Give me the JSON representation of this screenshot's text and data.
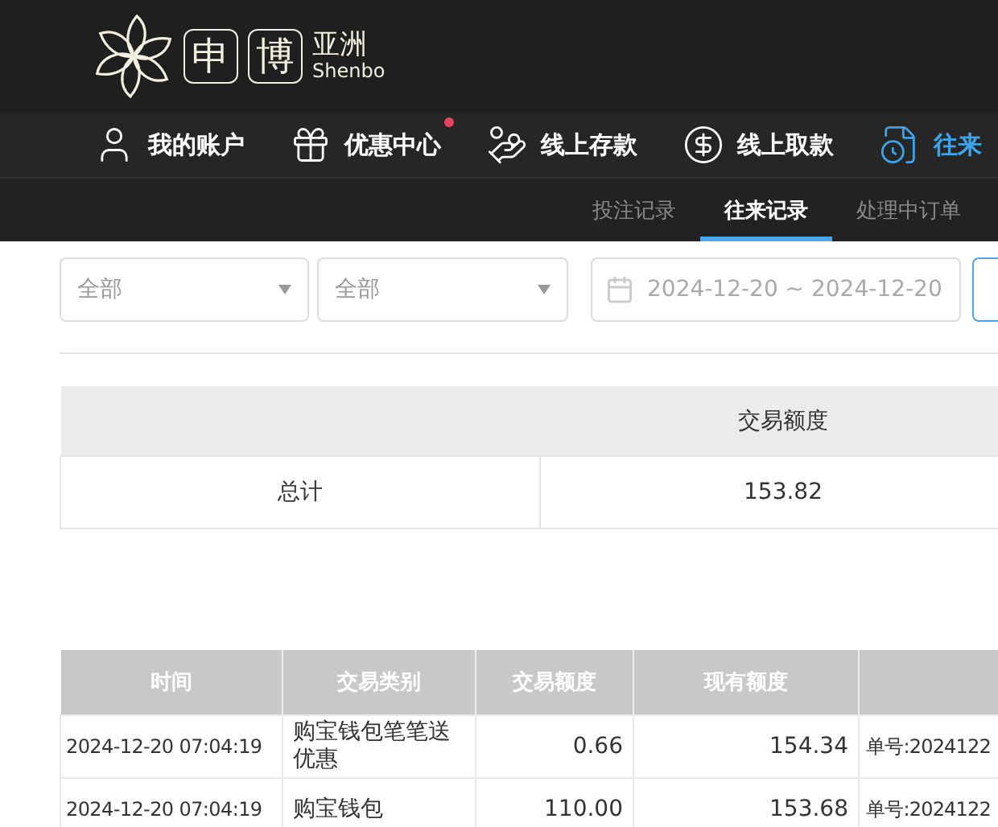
{
  "logo": {
    "boxed": [
      "申",
      "博"
    ],
    "name": "亚洲",
    "latin": "Shenbo"
  },
  "nav": [
    {
      "label": "我的账户",
      "kind": "user",
      "selected": false,
      "dot": false
    },
    {
      "label": "优惠中心",
      "kind": "gift",
      "selected": false,
      "dot": true
    },
    {
      "label": "线上存款",
      "kind": "deposit",
      "selected": false,
      "dot": false
    },
    {
      "label": "线上取款",
      "kind": "withdraw",
      "selected": false,
      "dot": false
    },
    {
      "label": "往来",
      "kind": "records",
      "selected": true,
      "dot": false
    }
  ],
  "subtabs": [
    {
      "label": "投注记录",
      "selected": false
    },
    {
      "label": "往来记录",
      "selected": true
    },
    {
      "label": "处理中订单",
      "selected": false
    }
  ],
  "filters": {
    "select_1": "全部",
    "select_2": "全部",
    "date_range": "2024-12-20 ~ 2024-12-20"
  },
  "summary": {
    "columns": [
      "",
      "交易额度"
    ],
    "rows": [
      [
        "总计",
        "153.82"
      ]
    ]
  },
  "table": {
    "columns": [
      "时间",
      "交易类别",
      "交易额度",
      "现有额度",
      ""
    ],
    "rows": [
      [
        "2024-12-20 07:04:19",
        "购宝钱包笔笔送优惠",
        "0.66",
        "154.34",
        "单号:2024122"
      ],
      [
        "2024-12-20 07:04:19",
        "购宝钱包",
        "110.00",
        "153.68",
        "单号:2024122"
      ]
    ]
  }
}
